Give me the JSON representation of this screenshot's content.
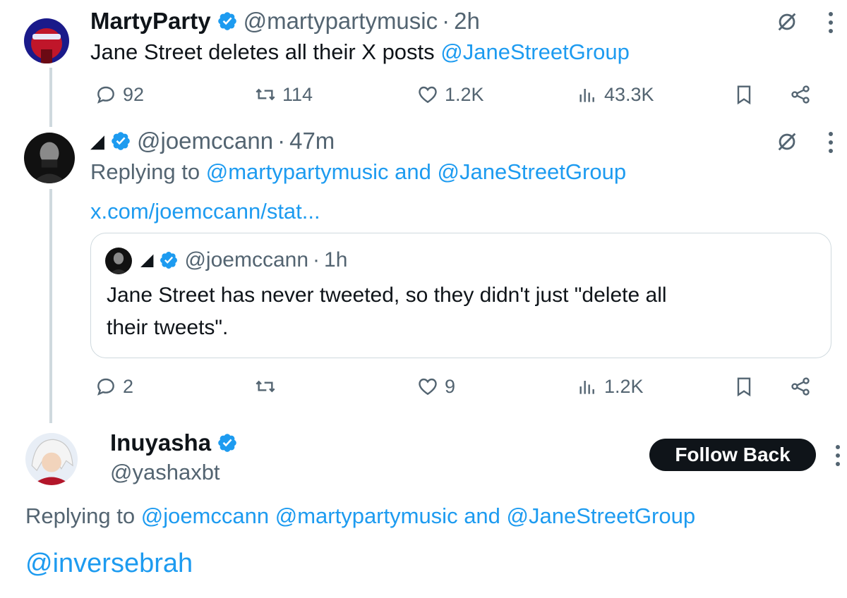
{
  "tweet1": {
    "name": "MartyParty",
    "handle": "@martypartymusic",
    "sep": "·",
    "time": "2h",
    "text": "Jane Street deletes all their X posts ",
    "mention": "@JaneStreetGroup",
    "replies": "92",
    "reposts": "114",
    "likes": "1.2K",
    "views": "43.3K"
  },
  "tweet2": {
    "name": "◢",
    "handle": "@joemccann",
    "sep": "·",
    "time": "47m",
    "replying_prefix": "Replying to ",
    "replying_to_1": "@martypartymusic",
    "and": " and ",
    "replying_to_2": "@JaneStreetGroup",
    "link": "x.com/joemccann/stat...",
    "replies": "2",
    "likes": "9",
    "views": "1.2K",
    "quote": {
      "name": "◢",
      "handle": "@joemccann",
      "sep": "·",
      "time": "1h",
      "line1": "Jane Street has never tweeted, so they didn't just \"delete all",
      "line2": "their tweets\"."
    }
  },
  "tweet3": {
    "name": "Inuyasha",
    "handle": "@yashaxbt",
    "follow_label": "Follow Back",
    "replying_prefix": "Replying to ",
    "replying_to_1": "@joemccann",
    "replying_to_2": "@martypartymusic",
    "and": " and ",
    "replying_to_3": "@JaneStreetGroup",
    "text": "@inversebrah"
  },
  "icons": {
    "verified": "verified-badge-icon",
    "reply": "reply-icon",
    "repost": "repost-icon",
    "like": "like-icon",
    "views": "views-icon",
    "bookmark": "bookmark-icon",
    "share": "share-icon",
    "grok": "grok-icon",
    "more": "more-icon"
  },
  "colors": {
    "accent": "#1d9bf0",
    "muted": "#536471",
    "text": "#0f1419",
    "border": "#cfd9de"
  }
}
